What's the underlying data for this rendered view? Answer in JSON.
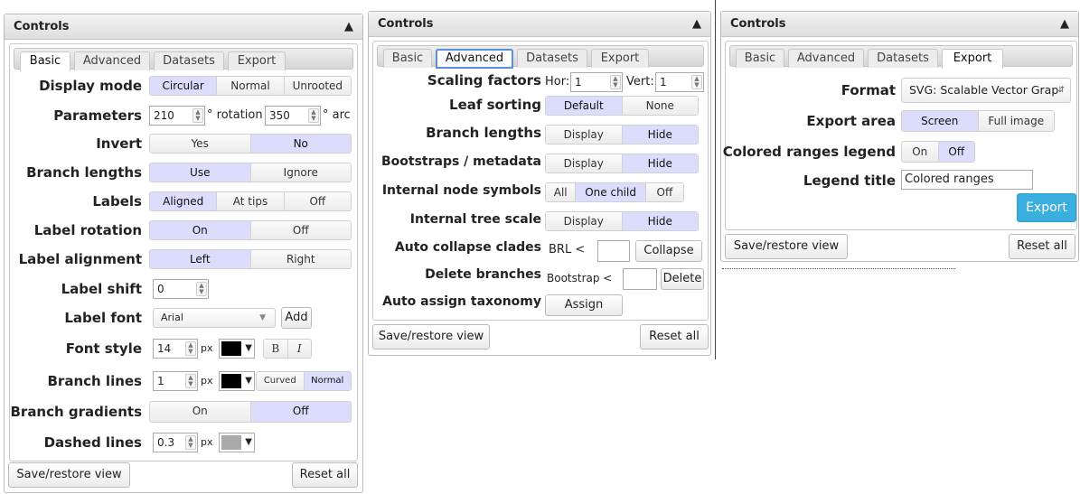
{
  "panel_title": "Controls",
  "tabs": {
    "basic": "Basic",
    "advanced": "Advanced",
    "datasets": "Datasets",
    "export": "Export"
  },
  "footer": {
    "save": "Save/restore view",
    "reset": "Reset all"
  },
  "basic": {
    "display_mode": {
      "label": "Display mode",
      "options": [
        "Circular",
        "Normal",
        "Unrooted"
      ],
      "selected": "Circular"
    },
    "parameters": {
      "label": "Parameters",
      "rotation_value": "210",
      "rotation_unit": "° rotation",
      "arc_value": "350",
      "arc_unit": "° arc"
    },
    "invert": {
      "label": "Invert",
      "options": [
        "Yes",
        "No"
      ],
      "selected": "No"
    },
    "branch_lengths": {
      "label": "Branch lengths",
      "options": [
        "Use",
        "Ignore"
      ],
      "selected": "Use"
    },
    "labels": {
      "label": "Labels",
      "options": [
        "Aligned",
        "At tips",
        "Off"
      ],
      "selected": "Aligned"
    },
    "label_rotation": {
      "label": "Label rotation",
      "options": [
        "On",
        "Off"
      ],
      "selected": "On"
    },
    "label_alignment": {
      "label": "Label alignment",
      "options": [
        "Left",
        "Right"
      ],
      "selected": "Left"
    },
    "label_shift": {
      "label": "Label shift",
      "value": "0"
    },
    "label_font": {
      "label": "Label font",
      "value": "Arial",
      "add": "Add"
    },
    "font_style": {
      "label": "Font style",
      "size": "14",
      "unit": "px",
      "color": "#000000",
      "bold": "B",
      "italic": "I"
    },
    "branch_lines": {
      "label": "Branch lines",
      "width": "1",
      "unit": "px",
      "color": "#000000",
      "options": [
        "Curved",
        "Normal"
      ],
      "selected": "Normal"
    },
    "branch_gradients": {
      "label": "Branch gradients",
      "options": [
        "On",
        "Off"
      ],
      "selected": "Off"
    },
    "dashed_lines": {
      "label": "Dashed lines",
      "value": "0.3",
      "unit": "px",
      "color": "#aaaaaa"
    }
  },
  "advanced": {
    "scaling": {
      "label": "Scaling factors",
      "hor_label": "Hor:",
      "hor_value": "1",
      "vert_label": "Vert:",
      "vert_value": "1"
    },
    "leaf_sorting": {
      "label": "Leaf sorting",
      "options": [
        "Default",
        "None"
      ],
      "selected": "Default"
    },
    "branch_lengths": {
      "label": "Branch lengths",
      "options": [
        "Display",
        "Hide"
      ],
      "selected": "Hide"
    },
    "bootstraps": {
      "label": "Bootstraps / metadata",
      "options": [
        "Display",
        "Hide"
      ],
      "selected": "Hide"
    },
    "internal_node_symbols": {
      "label": "Internal node symbols",
      "options": [
        "All",
        "One child",
        "Off"
      ],
      "selected": "One child"
    },
    "internal_tree_scale": {
      "label": "Internal tree scale",
      "options": [
        "Display",
        "Hide"
      ],
      "selected": "Hide"
    },
    "auto_collapse": {
      "label": "Auto collapse clades",
      "prefix": "BRL <",
      "button": "Collapse"
    },
    "delete_branches": {
      "label": "Delete branches",
      "prefix": "Bootstrap <",
      "button": "Delete"
    },
    "auto_assign": {
      "label": "Auto assign taxonomy",
      "button": "Assign"
    }
  },
  "export": {
    "format": {
      "label": "Format",
      "value": "SVG: Scalable Vector Grap"
    },
    "export_area": {
      "label": "Export area",
      "options": [
        "Screen",
        "Full image"
      ],
      "selected": "Screen"
    },
    "legend": {
      "label": "Colored ranges legend",
      "options": [
        "On",
        "Off"
      ],
      "selected": "Off"
    },
    "legend_title": {
      "label": "Legend title",
      "value": "Colored ranges"
    },
    "button": "Export",
    "accent": "#3aaede"
  }
}
